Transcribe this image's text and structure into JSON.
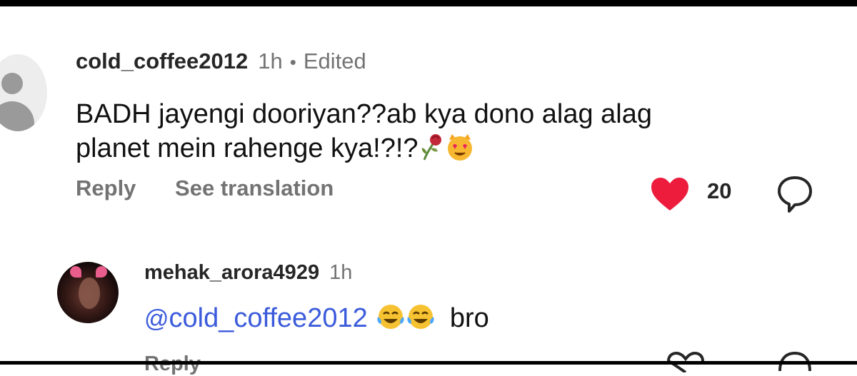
{
  "comments": [
    {
      "username": "cold_coffee2012",
      "time": "1h",
      "separator": "•",
      "edited": "Edited",
      "text_line1": "BADH jayengi dooriyan??ab kya dono alag alag",
      "text_line2": "planet mein rahenge kya!?!?",
      "emojis": [
        "wilted-rose-emoji",
        "heart-eyes-cat-emoji"
      ],
      "reply_label": "Reply",
      "translate_label": "See translation",
      "likes": "20",
      "liked": true,
      "avatar": "default-avatar-icon"
    },
    {
      "username": "mehak_arora4929",
      "time": "1h",
      "mention_symbol": "@",
      "mention": "cold_coffee2012",
      "emojis": [
        "tears-of-joy-emoji",
        "tears-of-joy-emoji"
      ],
      "text_after": "bro",
      "reply_label": "Reply",
      "avatar": "profile-photo"
    }
  ],
  "colors": {
    "heart": "#ed1c3c",
    "mention": "#3b5bdb",
    "muted": "#737373"
  }
}
